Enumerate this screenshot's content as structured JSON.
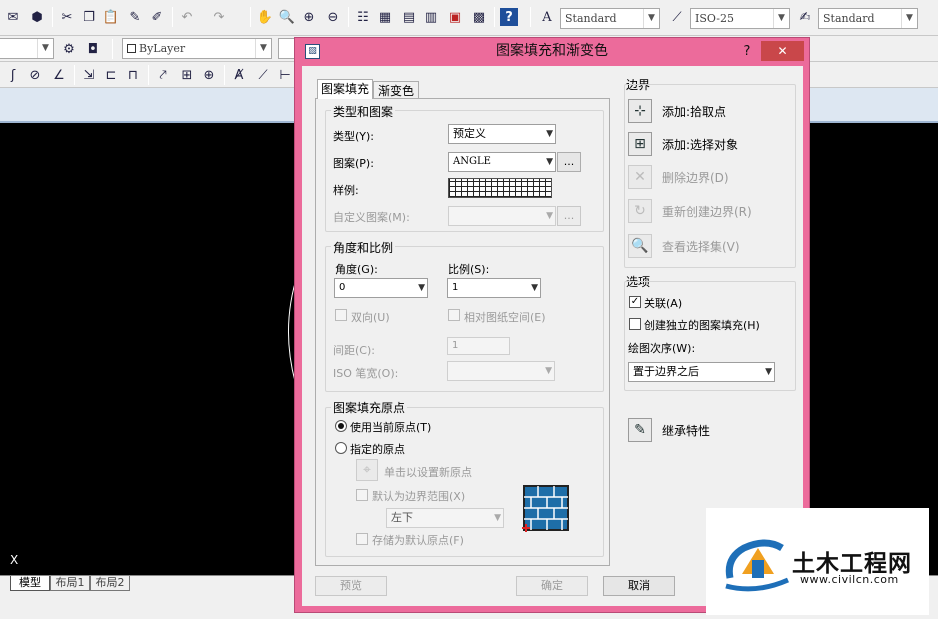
{
  "toolbar": {
    "text_style": "Standard",
    "dim_style": "ISO-25",
    "table_style": "Standard",
    "layer": "ByLayer"
  },
  "canvas": {
    "axis_label": "X",
    "layout_tabs": [
      "模型",
      "布局1",
      "布局2"
    ]
  },
  "dialog": {
    "title": "图案填充和渐变色",
    "help_label": "?",
    "close_label": "✕",
    "tabs": [
      "图案填充",
      "渐变色"
    ],
    "type_pattern": {
      "title": "类型和图案",
      "type_label": "类型(Y):",
      "type_value": "预定义",
      "pattern_label": "图案(P):",
      "pattern_value": "ANGLE",
      "browse_label": "...",
      "sample_label": "样例:",
      "custom_label": "自定义图案(M):",
      "custom_browse": "..."
    },
    "angle_scale": {
      "title": "角度和比例",
      "angle_label": "角度(G):",
      "angle_value": "0",
      "scale_label": "比例(S):",
      "scale_value": "1",
      "double_label": "双向(U)",
      "relative_label": "相对图纸空间(E)",
      "spacing_label": "间距(C):",
      "spacing_value": "1",
      "iso_label": "ISO 笔宽(O):"
    },
    "origin": {
      "title": "图案填充原点",
      "current_label": "使用当前原点(T)",
      "specified_label": "指定的原点",
      "click_set_label": "单击以设置新原点",
      "default_extent_label": "默认为边界范围(X)",
      "position_value": "左下",
      "store_default_label": "存储为默认原点(F)"
    },
    "boundary": {
      "title": "边界",
      "add_pick": "添加:拾取点",
      "add_select": "添加:选择对象",
      "remove": "删除边界(D)",
      "recreate": "重新创建边界(R)",
      "view_selection": "查看选择集(V)"
    },
    "options": {
      "title": "选项",
      "associative": "关联(A)",
      "independent": "创建独立的图案填充(H)",
      "draw_order_label": "绘图次序(W):",
      "draw_order_value": "置于边界之后"
    },
    "inherit_label": "继承特性",
    "buttons": {
      "preview": "预览",
      "ok": "确定",
      "cancel": "取消"
    }
  },
  "watermark": {
    "brand": "土木工程网",
    "url": "www.civilcn.com"
  }
}
